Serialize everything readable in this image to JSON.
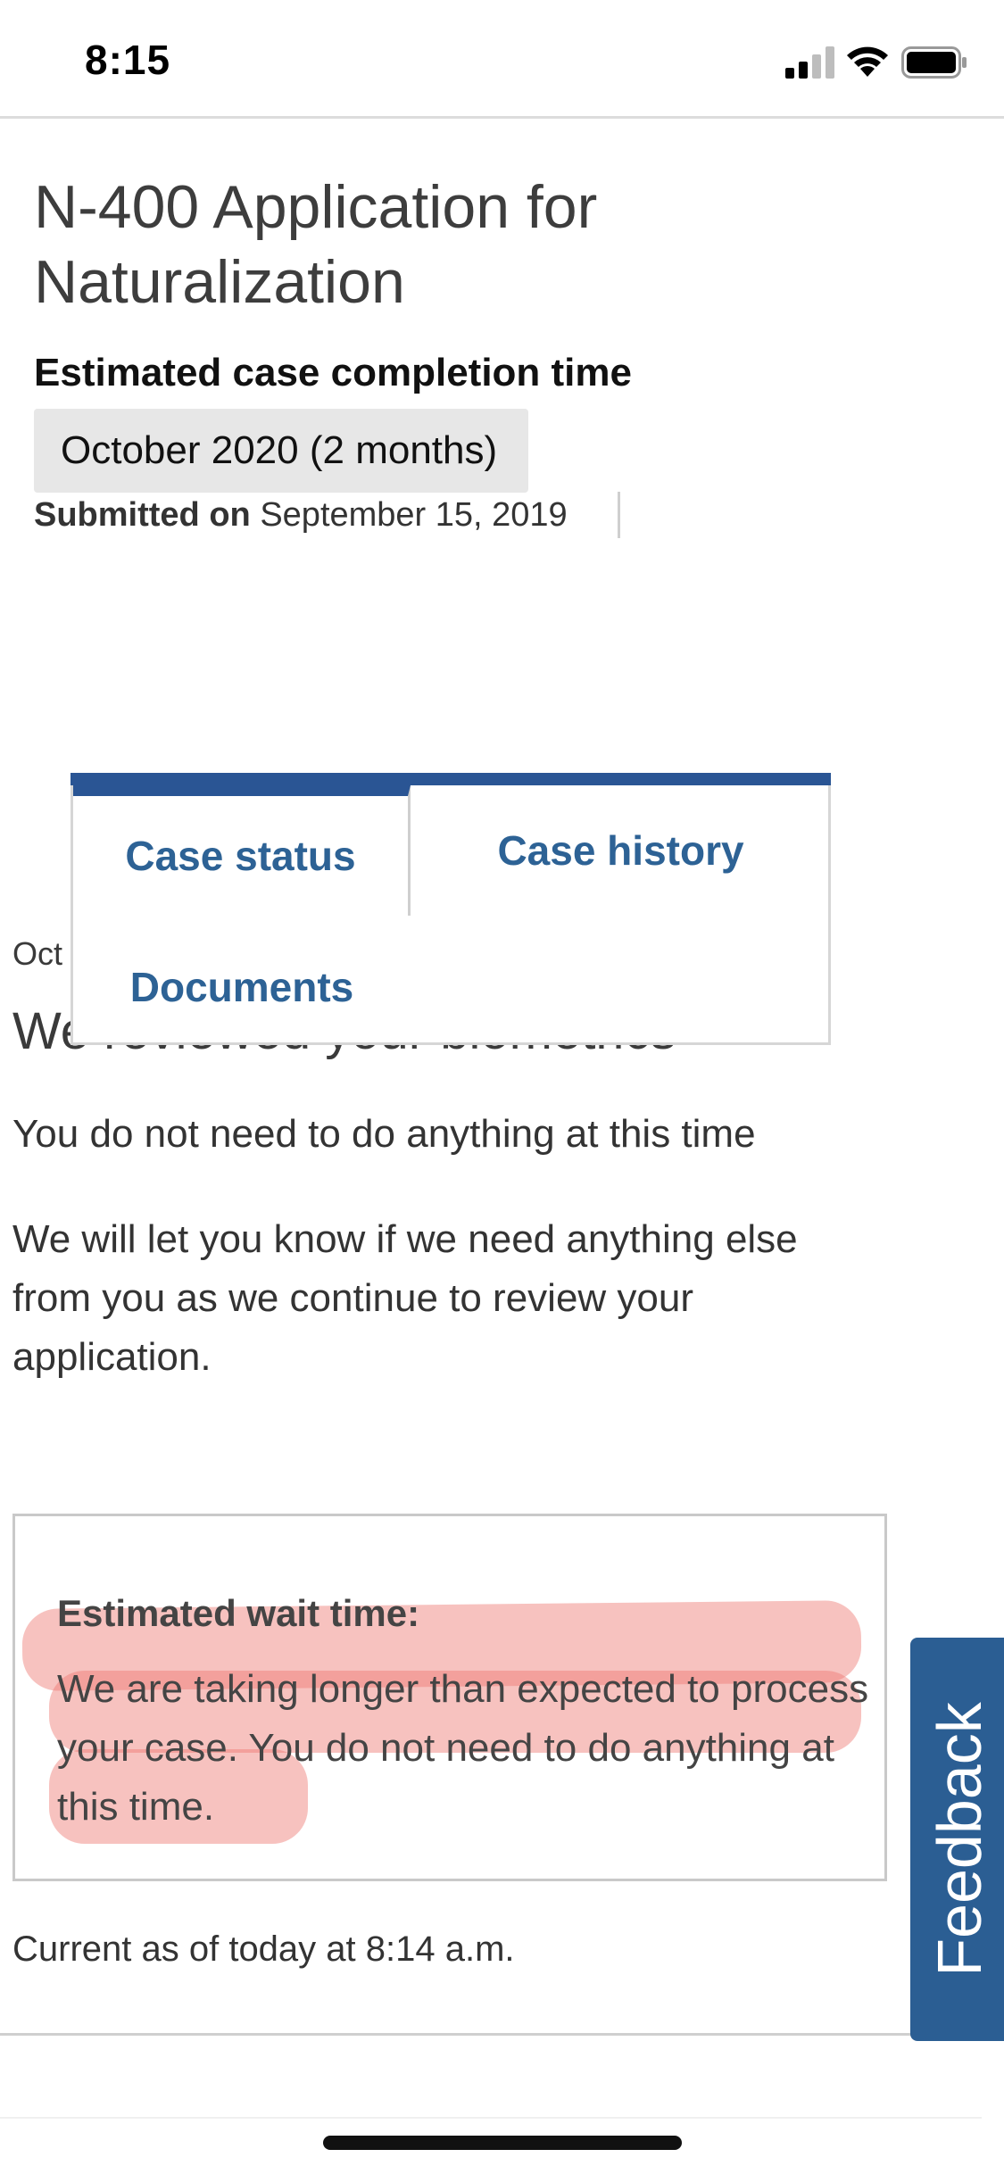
{
  "status_bar": {
    "time": "8:15"
  },
  "case": {
    "title": "N-400 Application for Naturalization",
    "completion_heading": "Estimated case completion time",
    "completion_value": "October 2020 (2 months)",
    "submitted_label": "Submitted on",
    "submitted_date": "September 15, 2019"
  },
  "tabs": {
    "items": [
      {
        "label": "Case status",
        "selected": true
      },
      {
        "label": "Case history",
        "selected": false
      },
      {
        "label": "Documents",
        "selected": false
      }
    ]
  },
  "event": {
    "date_fragment": "Oct",
    "heading": "We reviewed your biometrics"
  },
  "body": {
    "line_1": "You do not need to do anything at this time",
    "paragraph_2": "We will let you know if we need anything else from you as we continue to review your application."
  },
  "wait_time": {
    "heading": "Estimated wait time:",
    "text": "We are taking longer than expected to process your case. You do not need to do anything at this time."
  },
  "footer": {
    "current_as_of": "Current as of today at 8:14 a.m."
  },
  "feedback": {
    "label": "Feedback"
  },
  "colors": {
    "accent": "#2a5594",
    "tab_text": "#2d6295",
    "highlight": "#ee7870",
    "feedback_bg": "#2b5e93"
  }
}
